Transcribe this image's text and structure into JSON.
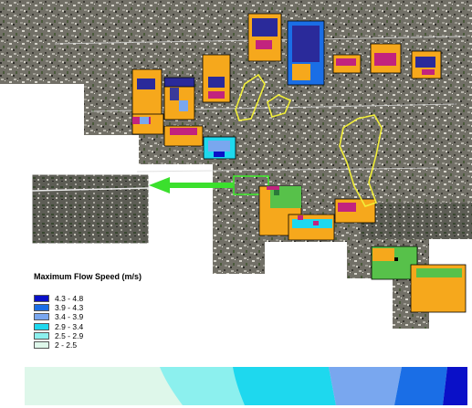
{
  "legend": {
    "title": "Maximum Flow Speed (m/s)",
    "items": [
      {
        "label": "4.3 - 4.8",
        "color": "#0a10c8"
      },
      {
        "label": "3.9 - 4.3",
        "color": "#1a6ee6"
      },
      {
        "label": "3.4 - 3.9",
        "color": "#79a7ef"
      },
      {
        "label": "2.9 - 3.4",
        "color": "#1ed8ee"
      },
      {
        "label": "2.5 - 2.9",
        "color": "#8cf0ee"
      },
      {
        "label": "2 - 2.5",
        "color": "#def7ea"
      }
    ]
  },
  "colors": {
    "patch_orange": "#f6a81c",
    "patch_green": "#57c14a",
    "patch_magenta": "#c2237e",
    "slide_outline": "#f2ef3a",
    "inset_box": "#41e62e",
    "arrow": "#3be02d",
    "terrain": "#6b6b62"
  }
}
